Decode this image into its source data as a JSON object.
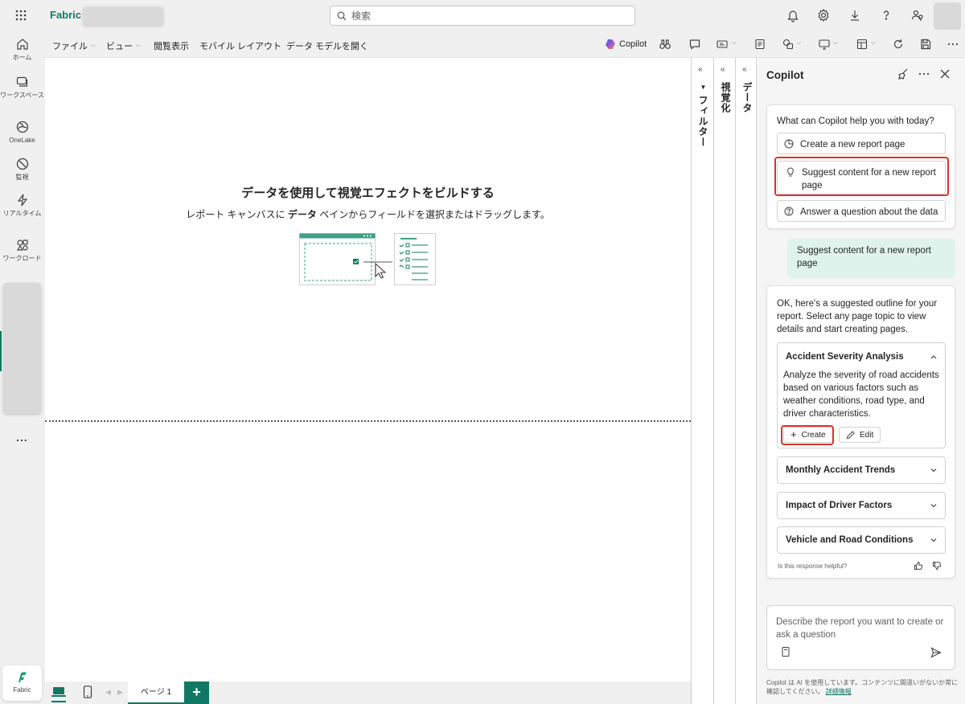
{
  "topbar": {
    "brand": "Fabric",
    "search_placeholder": "検索"
  },
  "rail": {
    "items": [
      {
        "label": "ホーム"
      },
      {
        "label": "ワークスペース"
      },
      {
        "label": "OneLake"
      },
      {
        "label": "監視"
      },
      {
        "label": "リアルタイム"
      },
      {
        "label": "ワークロード"
      }
    ],
    "more": "...",
    "fabric_label": "Fabric"
  },
  "toolbar": {
    "menus": [
      "ファイル",
      "ビュー",
      "閲覧表示",
      "モバイル レイアウト",
      "データ モデルを開く"
    ],
    "copilot_label": "Copilot"
  },
  "canvas": {
    "title": "データを使用して視覚エフェクトをビルドする",
    "subtitle_pre": "レポート キャンバスに ",
    "subtitle_bold": "データ",
    "subtitle_post": " ペインからフィールドを選択またはドラッグします。"
  },
  "bottombar": {
    "page_tab": "ページ 1",
    "add_page": "+"
  },
  "panes": {
    "filters": "フィルター",
    "visualizations": "視覚化",
    "data": "データ"
  },
  "copilot": {
    "title": "Copilot",
    "prompt_question": "What can Copilot help you with today?",
    "options": [
      "Create a new report page",
      "Suggest content for a new report page",
      "Answer a question about the data"
    ],
    "user_message": "Suggest content for a new report page",
    "response_intro": "OK, here's a suggested outline for your report. Select any page topic to view details and start creating pages.",
    "outline": [
      {
        "title": "Accident Severity Analysis",
        "description": "Analyze the severity of road accidents based on various factors such as weather conditions, road type, and driver characteristics."
      },
      {
        "title": "Monthly Accident Trends"
      },
      {
        "title": "Impact of Driver Factors"
      },
      {
        "title": "Vehicle and Road Conditions"
      }
    ],
    "create_label": "Create",
    "edit_label": "Edit",
    "helpful_text": "Is this response helpful?",
    "input_placeholder": "Describe the report you want to create or ask a question",
    "disclaimer": "Copilot は AI を使用しています。コンテンツに間違いがないか常に確認してください。",
    "learn_more": "詳細情報"
  },
  "colors": {
    "brand": "#117865",
    "highlight": "#e03030",
    "user_bubble": "#dff3ec"
  }
}
